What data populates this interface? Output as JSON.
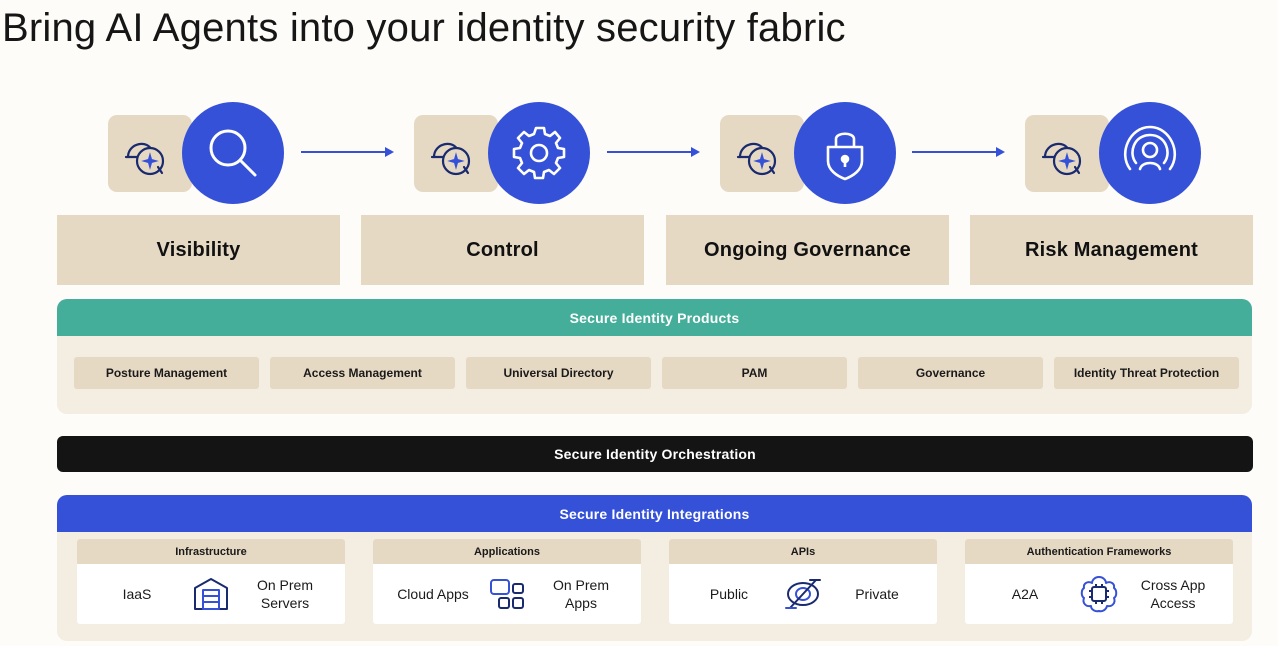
{
  "title": "Bring AI Agents into your identity security fabric",
  "stages": [
    {
      "label": "Visibility",
      "icon": "search-icon"
    },
    {
      "label": "Control",
      "icon": "gear-icon"
    },
    {
      "label": "Ongoing Governance",
      "icon": "lock-shield-icon"
    },
    {
      "label": "Risk Management",
      "icon": "user-signal-icon"
    }
  ],
  "products": {
    "header": "Secure Identity Products",
    "items": [
      "Posture Management",
      "Access Management",
      "Universal Directory",
      "PAM",
      "Governance",
      "Identity Threat Protection"
    ]
  },
  "orchestration": {
    "label": "Secure Identity Orchestration"
  },
  "integrations": {
    "header": "Secure Identity Integrations",
    "cards": [
      {
        "title": "Infrastructure",
        "left": "IaaS",
        "right": "On Prem Servers",
        "icon": "server-icon"
      },
      {
        "title": "Applications",
        "left": "Cloud Apps",
        "right": "On Prem Apps",
        "icon": "apps-grid-icon"
      },
      {
        "title": "APIs",
        "left": "Public",
        "right": "Private",
        "icon": "api-icon"
      },
      {
        "title": "Authentication Frameworks",
        "left": "A2A",
        "right": "Cross App Access",
        "icon": "chip-icon"
      }
    ]
  },
  "colors": {
    "blue": "#3551d8",
    "teal": "#45ae9a",
    "tan": "#e6d9c4",
    "cream": "#f3ede2",
    "black": "#141414"
  }
}
